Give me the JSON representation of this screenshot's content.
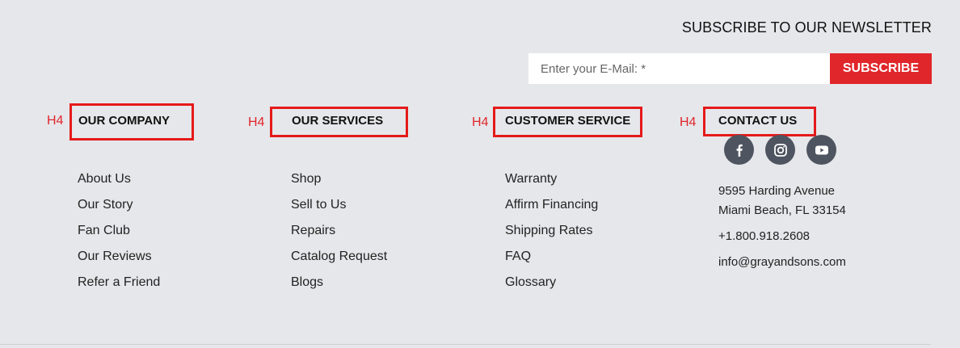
{
  "newsletter": {
    "title": "SUBSCRIBE TO OUR NEWSLETTER",
    "email_placeholder": "Enter your E-Mail: *",
    "subscribe_label": "SUBSCRIBE",
    "accent_color": "#e0262b"
  },
  "annotation_tag": "H4",
  "columns": [
    {
      "heading": "OUR COMPANY",
      "links": [
        "About Us",
        "Our Story",
        "Fan Club",
        "Our Reviews",
        "Refer a Friend"
      ]
    },
    {
      "heading": "OUR SERVICES",
      "links": [
        "Shop",
        "Sell to Us",
        "Repairs",
        "Catalog Request",
        "Blogs"
      ]
    },
    {
      "heading": "CUSTOMER SERVICE",
      "links": [
        "Warranty",
        "Affirm Financing",
        "Shipping Rates",
        "FAQ",
        "Glossary"
      ]
    },
    {
      "heading": "CONTACT US",
      "social": [
        "facebook-icon",
        "instagram-icon",
        "youtube-icon"
      ],
      "address_line1": "9595 Harding Avenue",
      "address_line2": "Miami Beach, FL 33154",
      "phone": "+1.800.918.2608",
      "email": "info@grayandsons.com"
    }
  ]
}
